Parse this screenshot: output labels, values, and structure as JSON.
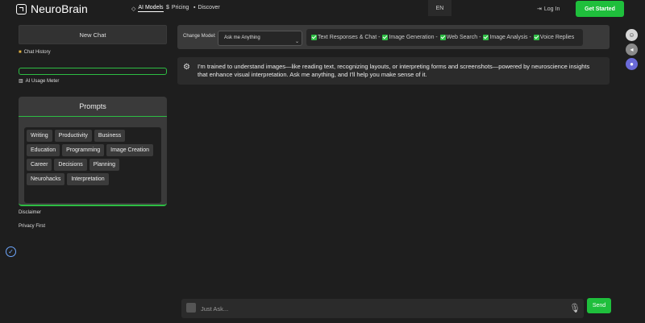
{
  "header": {
    "brand": "NeuroBrain",
    "nav": [
      {
        "label": "AI Models",
        "icon": "diamond-icon",
        "active": true
      },
      {
        "label": "Pricing",
        "icon": "dollar-icon",
        "active": false
      },
      {
        "label": "Discover",
        "icon": "folder-icon",
        "active": false
      }
    ],
    "language": "EN",
    "login": "Log In",
    "cta": "Get Started"
  },
  "sidebar": {
    "new_chat": "New Chat",
    "chat_history": "Chat History",
    "usage_meter": "AI Usage Meter",
    "usage_fraction": 0.0,
    "prompts_title": "Prompts",
    "prompt_chips": [
      "Writing",
      "Productivity",
      "Business",
      "Education",
      "Programming",
      "Image Creation",
      "Career",
      "Decisions",
      "Planning",
      "Neurohacks",
      "Interpretation"
    ],
    "disclaimer": "Disclaimer",
    "privacy": "Privacy First"
  },
  "model": {
    "change_label": "Change Model:",
    "selected": "Ask me Anything",
    "features": [
      "Text Responses & Chat -",
      "Image Generation -",
      "Web Search -",
      "Image Analysis -",
      "Voice Replies"
    ]
  },
  "message": {
    "text": "I'm trained to understand images—like reading text, recognizing layouts, or interpreting forms and screenshots—powered by neuroscience insights that enhance visual interpretation. Ask me anything, and I'll help you make sense of it."
  },
  "composer": {
    "placeholder": "Just Ask...",
    "send": "Send"
  },
  "colors": {
    "accent": "#1fbf3c",
    "background": "#1e1e1e",
    "panel": "#3a3a3a"
  }
}
